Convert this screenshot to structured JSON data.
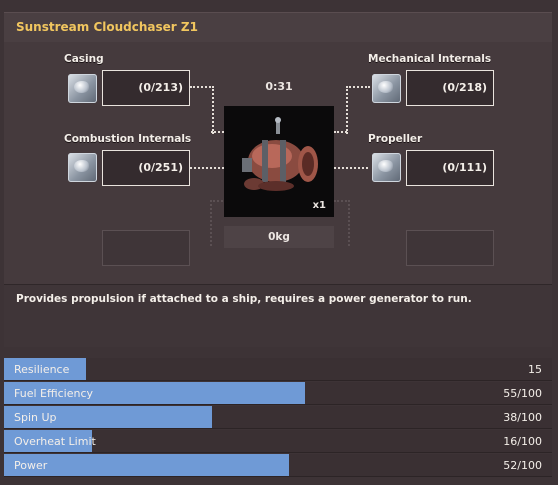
{
  "title": "Sunstream Cloudchaser Z1",
  "recipe": {
    "timer": "0:31",
    "weight": "0kg",
    "multiplier": "x1",
    "ingredients": [
      {
        "label": "Casing",
        "count": "(0/213)"
      },
      {
        "label": "Combustion Internals",
        "count": "(0/251)"
      },
      {
        "label": "Mechanical Internals",
        "count": "(0/218)"
      },
      {
        "label": "Propeller",
        "count": "(0/111)"
      }
    ]
  },
  "description": "Provides propulsion if attached to a ship, requires a power generator to run.",
  "stats": [
    {
      "label": "Resilience",
      "value": "15",
      "fill": 0.15
    },
    {
      "label": "Fuel Efficiency",
      "value": "55/100",
      "fill": 0.55
    },
    {
      "label": "Spin Up",
      "value": "38/100",
      "fill": 0.38
    },
    {
      "label": "Overheat Limit",
      "value": "16/100",
      "fill": 0.16
    },
    {
      "label": "Power",
      "value": "52/100",
      "fill": 0.52
    }
  ],
  "colors": {
    "title": "#f1c65f",
    "stat_fill": "#6f9ad6",
    "background": "#3d3336"
  }
}
